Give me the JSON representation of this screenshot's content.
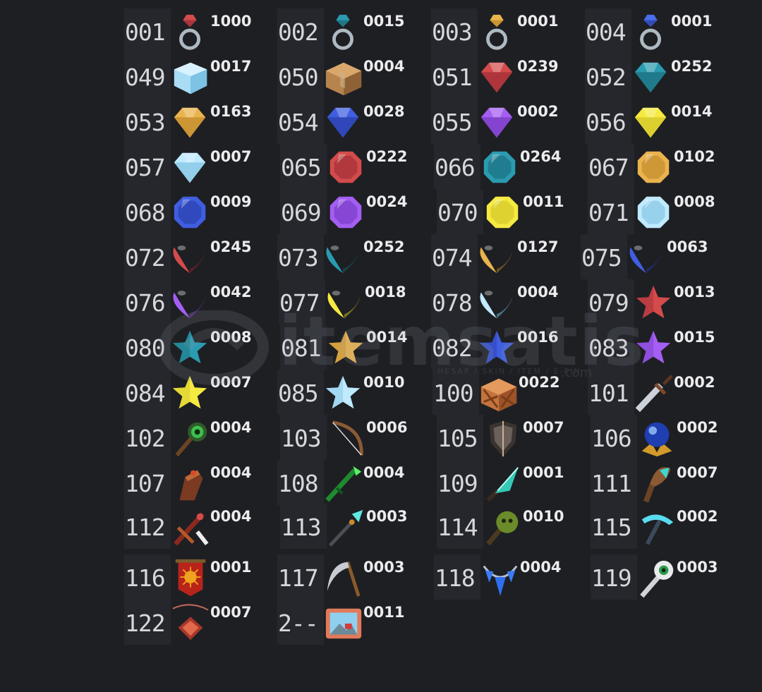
{
  "watermark": {
    "brand": "itemsatis",
    "tagline": "HESAP / SKIN / ITEM / E-PIN",
    "dotcom": ".com"
  },
  "items": [
    {
      "id": "001",
      "count": "1000",
      "icon": "ring-ruby-icon"
    },
    {
      "id": "002",
      "count": "0015",
      "icon": "ring-teal-icon"
    },
    {
      "id": "003",
      "count": "0001",
      "icon": "ring-gold-icon"
    },
    {
      "id": "004",
      "count": "0001",
      "icon": "ring-sapphire-icon"
    },
    {
      "id": "049",
      "count": "0017",
      "icon": "ice-cube-icon"
    },
    {
      "id": "050",
      "count": "0004",
      "icon": "cardboard-box-icon"
    },
    {
      "id": "051",
      "count": "0239",
      "icon": "red-gem-icon"
    },
    {
      "id": "052",
      "count": "0252",
      "icon": "teal-gem-icon"
    },
    {
      "id": "053",
      "count": "0163",
      "icon": "gold-gem-icon"
    },
    {
      "id": "054",
      "count": "0028",
      "icon": "blue-gem-icon"
    },
    {
      "id": "055",
      "count": "0002",
      "icon": "purple-gem-icon"
    },
    {
      "id": "056",
      "count": "0014",
      "icon": "yellow-gem-icon"
    },
    {
      "id": "057",
      "count": "0007",
      "icon": "diamond-gem-icon"
    },
    {
      "id": "065",
      "count": "0222",
      "icon": "red-octagon-icon"
    },
    {
      "id": "066",
      "count": "0264",
      "icon": "teal-octagon-icon"
    },
    {
      "id": "067",
      "count": "0102",
      "icon": "gold-octagon-icon"
    },
    {
      "id": "068",
      "count": "0009",
      "icon": "blue-octagon-icon"
    },
    {
      "id": "069",
      "count": "0024",
      "icon": "purple-octagon-icon"
    },
    {
      "id": "070",
      "count": "0011",
      "icon": "yellow-octagon-icon"
    },
    {
      "id": "071",
      "count": "0008",
      "icon": "diamond-octagon-icon"
    },
    {
      "id": "072",
      "count": "0245",
      "icon": "red-heart-icon"
    },
    {
      "id": "073",
      "count": "0252",
      "icon": "teal-heart-icon"
    },
    {
      "id": "074",
      "count": "0127",
      "icon": "gold-heart-icon"
    },
    {
      "id": "075",
      "count": "0063",
      "icon": "blue-heart-icon"
    },
    {
      "id": "076",
      "count": "0042",
      "icon": "purple-heart-icon"
    },
    {
      "id": "077",
      "count": "0018",
      "icon": "yellow-heart-icon"
    },
    {
      "id": "078",
      "count": "0004",
      "icon": "diamond-heart-icon"
    },
    {
      "id": "079",
      "count": "0013",
      "icon": "red-star-icon"
    },
    {
      "id": "080",
      "count": "0008",
      "icon": "teal-star-icon"
    },
    {
      "id": "081",
      "count": "0014",
      "icon": "gold-star-icon"
    },
    {
      "id": "082",
      "count": "0016",
      "icon": "blue-star-icon"
    },
    {
      "id": "083",
      "count": "0015",
      "icon": "purple-star-icon"
    },
    {
      "id": "084",
      "count": "0007",
      "icon": "yellow-star-icon"
    },
    {
      "id": "085",
      "count": "0010",
      "icon": "diamond-star-icon"
    },
    {
      "id": "100",
      "count": "0022",
      "icon": "wooden-crate-icon"
    },
    {
      "id": "101",
      "count": "0002",
      "icon": "sword-icon"
    },
    {
      "id": "102",
      "count": "0004",
      "icon": "nature-staff-icon"
    },
    {
      "id": "103",
      "count": "0006",
      "icon": "bow-icon"
    },
    {
      "id": "105",
      "count": "0007",
      "icon": "shield-icon"
    },
    {
      "id": "106",
      "count": "0002",
      "icon": "crystal-orb-icon"
    },
    {
      "id": "107",
      "count": "0004",
      "icon": "gauntlet-icon"
    },
    {
      "id": "108",
      "count": "0004",
      "icon": "emerald-wand-icon"
    },
    {
      "id": "109",
      "count": "0001",
      "icon": "crystal-dagger-icon"
    },
    {
      "id": "111",
      "count": "0007",
      "icon": "crystal-club-icon"
    },
    {
      "id": "112",
      "count": "0004",
      "icon": "feathered-crossbow-icon"
    },
    {
      "id": "113",
      "count": "0003",
      "icon": "crystal-spear-icon"
    },
    {
      "id": "114",
      "count": "0010",
      "icon": "skull-mace-icon"
    },
    {
      "id": "115",
      "count": "0002",
      "icon": "crystal-pickaxe-icon"
    },
    {
      "id": "116",
      "count": "0001",
      "icon": "sun-banner-icon"
    },
    {
      "id": "117",
      "count": "0003",
      "icon": "scythe-icon"
    },
    {
      "id": "118",
      "count": "0004",
      "icon": "crystal-necklace-icon"
    },
    {
      "id": "119",
      "count": "0003",
      "icon": "eye-staff-icon"
    },
    {
      "id": "122",
      "count": "0007",
      "icon": "amulet-icon"
    },
    {
      "id": "2--",
      "count": "0011",
      "icon": "picture-frame-icon"
    }
  ]
}
